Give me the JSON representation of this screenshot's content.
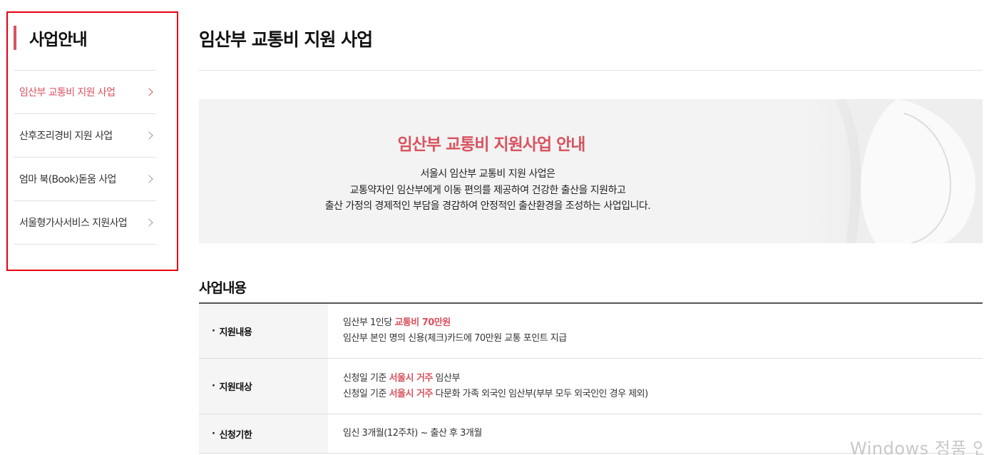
{
  "sidebar": {
    "title": "사업안내",
    "items": [
      {
        "label": "임산부 교통비 지원 사업",
        "active": true
      },
      {
        "label": "산후조리경비 지원 사업",
        "active": false
      },
      {
        "label": "엄마 북(Book)돋움 사업",
        "active": false
      },
      {
        "label": "서울형가사서비스 지원사업",
        "active": false
      }
    ]
  },
  "main": {
    "page_title": "임산부 교통비 지원 사업",
    "banner": {
      "heading": "임산부 교통비 지원사업 안내",
      "lines": [
        "서울시 임산부 교통비 지원 사업은",
        "교통약자인 임산부에게 이동 편의를 제공하여 건강한 출산을 지원하고",
        "출산 가정의 경제적인 부담을 경감하여 안정적인 출산환경을 조성하는 사업입니다."
      ]
    },
    "section_title": "사업내용",
    "table": {
      "bullet": "·",
      "rows": [
        {
          "label": "지원내용",
          "line1_pre": "임산부 1인당 ",
          "line1_hl": "교통비 70만원",
          "line1_post": "",
          "line2": "임산부 본인 명의 신용(체크)카드에 70만원 교통 포인트 지급"
        },
        {
          "label": "지원대상",
          "line1_pre": "신청일 기준 ",
          "line1_hl": "서울시 거주",
          "line1_post": " 임산부",
          "line2_pre": "신청일 기준 ",
          "line2_hl": "서울시 거주",
          "line2_post": " 다문화 가족 외국인 임산부(부부 모두 외국인인 경우 제외)"
        },
        {
          "label": "신청기한",
          "line1": "임신 3개월(12주차) ~ 출산 후 3개월"
        }
      ]
    }
  },
  "watermark": "Windows 정품 인",
  "colors": {
    "accent": "#d9535f",
    "highlight_box": "#e60012",
    "table_header_bg": "#f5f5f5",
    "banner_bg": "#f3f3f3"
  },
  "icons": {
    "nav_arrow": "chevron-right-icon"
  }
}
